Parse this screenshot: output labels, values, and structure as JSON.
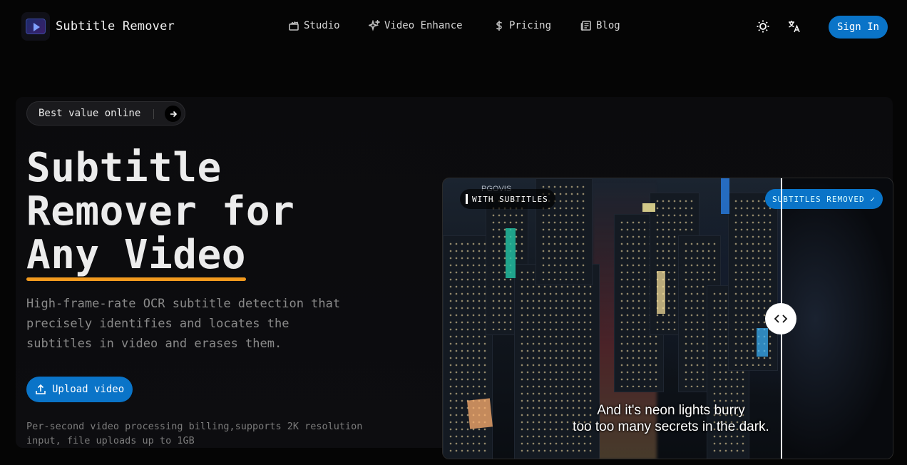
{
  "header": {
    "brand": "Subtitle Remover",
    "nav": [
      {
        "label": "Studio",
        "icon": "clapperboard-icon"
      },
      {
        "label": "Video Enhance",
        "icon": "sparkles-icon"
      },
      {
        "label": "Pricing",
        "icon": "dollar-icon"
      },
      {
        "label": "Blog",
        "icon": "newspaper-icon"
      }
    ],
    "theme_icon": "sun-icon",
    "language_icon": "translate-icon",
    "sign_in": "Sign In"
  },
  "hero": {
    "badge": "Best value online",
    "title_line1": "Subtitle",
    "title_line2": "Remover for",
    "title_line3": "Any Video",
    "description": "High-frame-rate OCR subtitle detection that precisely identifies and locates the subtitles in video and erases them.",
    "upload_button": "Upload video",
    "note": "Per-second video processing billing,supports 2K resolution input, file uploads up to 1GB"
  },
  "comparison": {
    "label_before": "WITH SUBTITLES",
    "label_after": "SUBTITLES REMOVED ✓",
    "subtitle_line1": "And it's neon lights burry",
    "subtitle_line2": "too too many secrets in the dark.",
    "watermark": "PGOVIS"
  },
  "colors": {
    "accent": "#0a74c8",
    "underline": "#f29a1e",
    "background": "#050505"
  }
}
